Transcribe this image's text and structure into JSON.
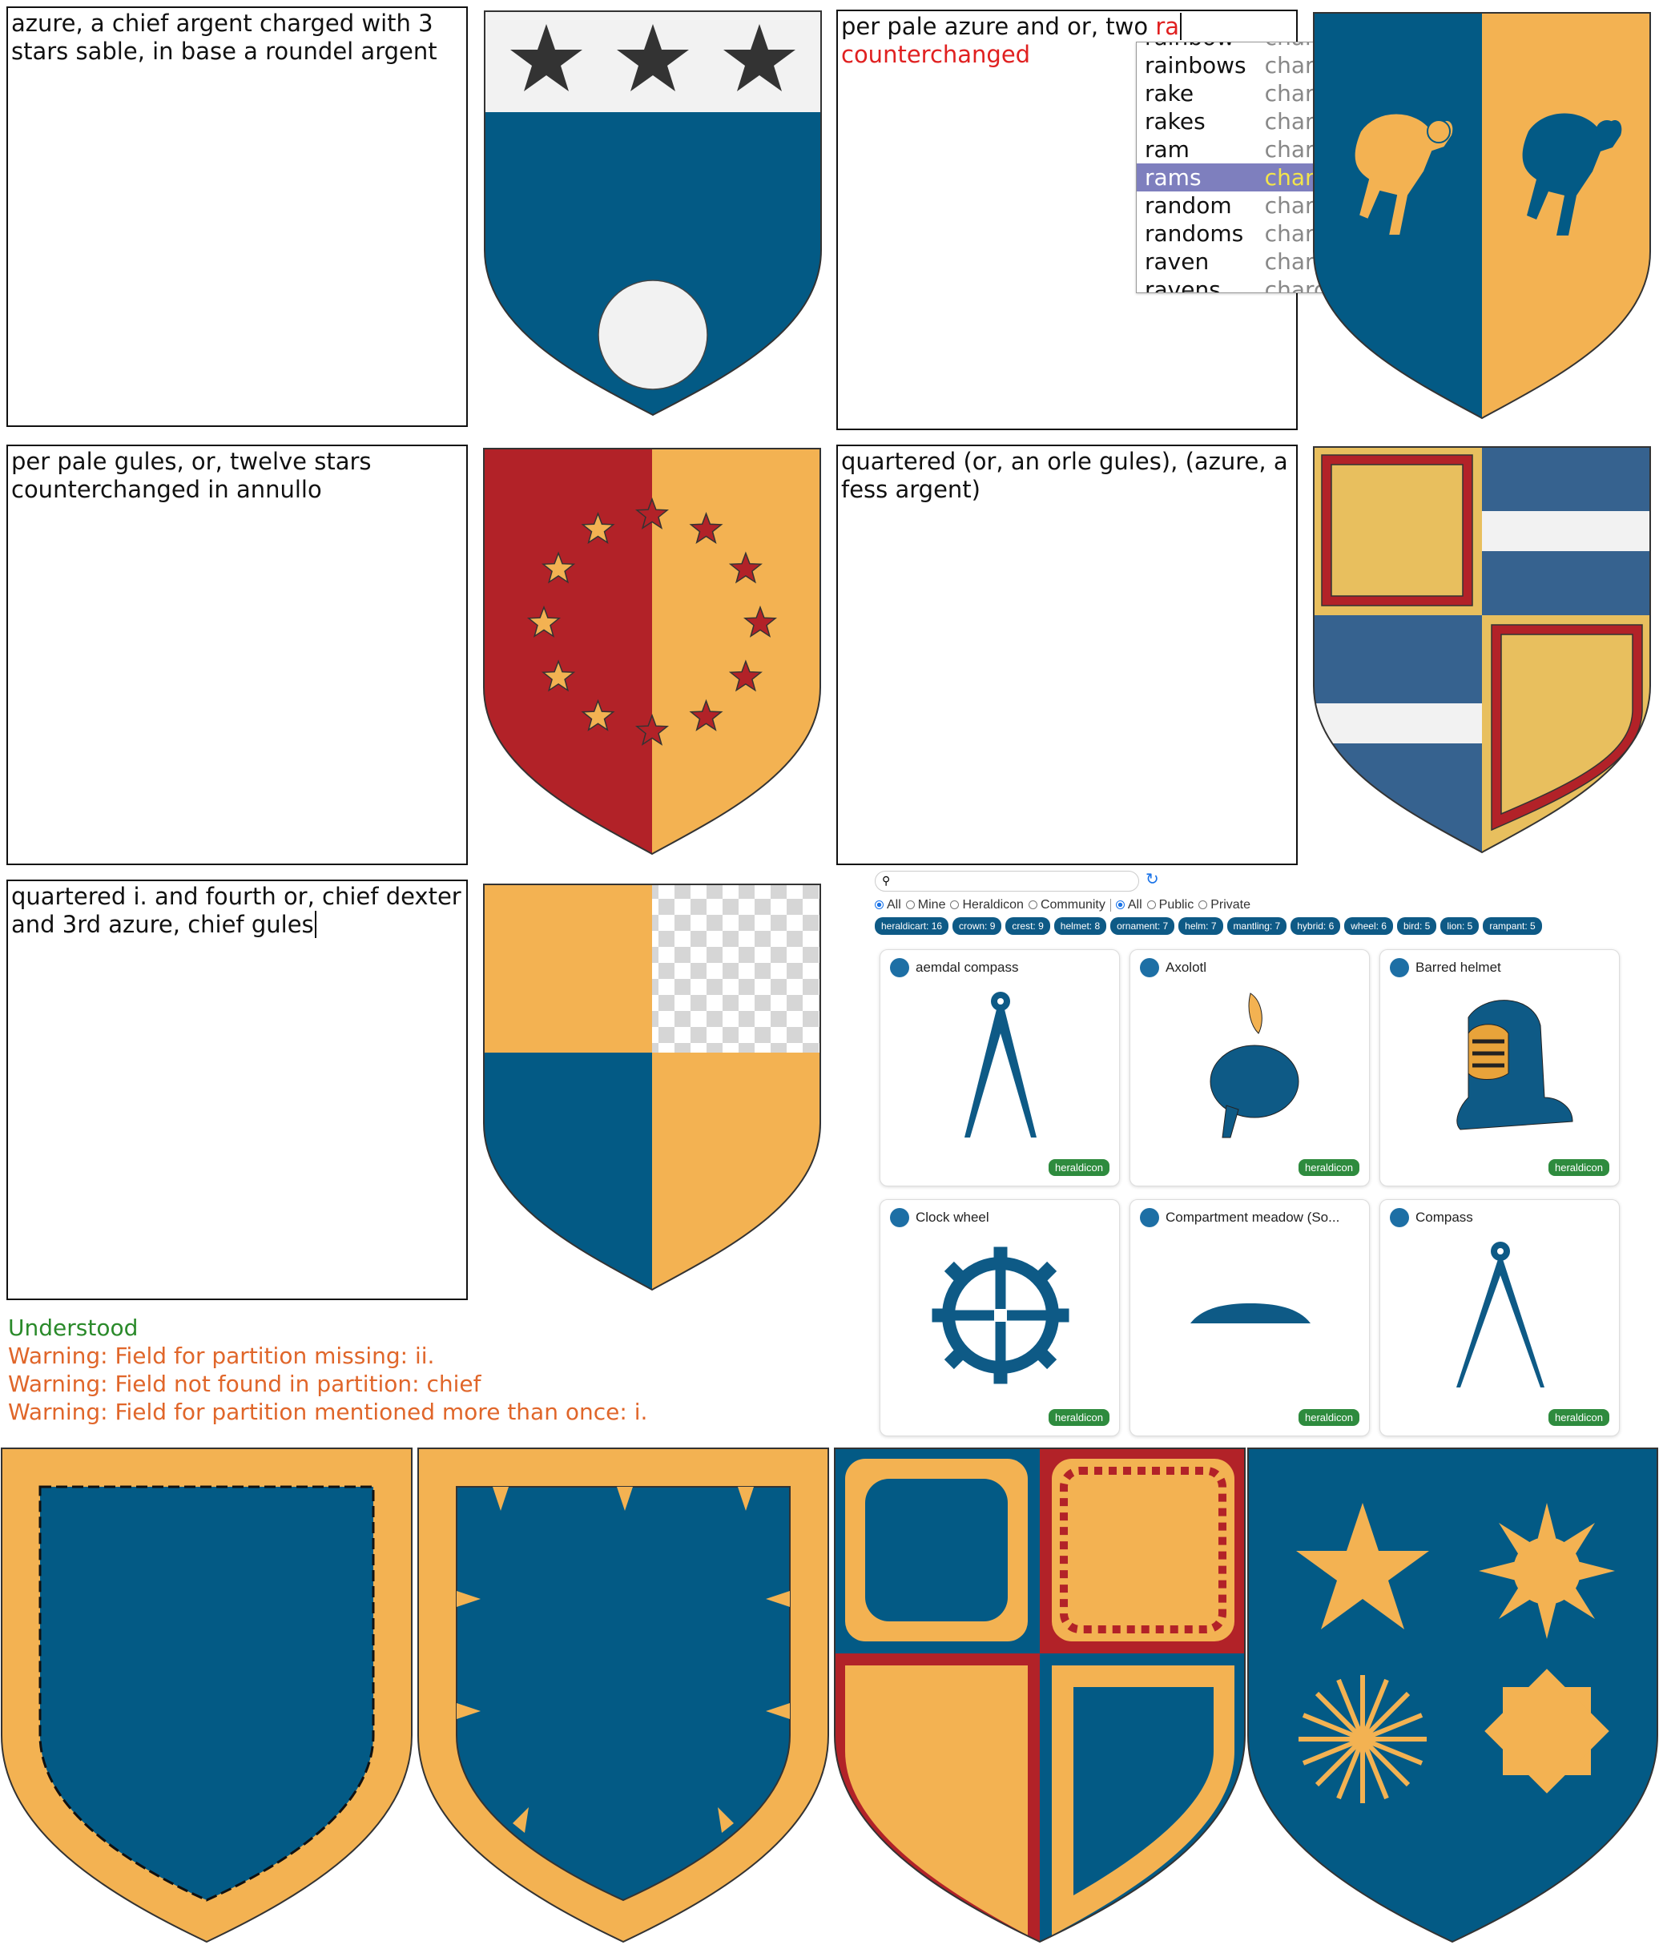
{
  "colors": {
    "azure": "#035a85",
    "or": "#f3b252",
    "gules": "#b22228",
    "argent": "#f2f2f2",
    "sable": "#333333"
  },
  "examples": [
    {
      "blazon": "azure, a chief argent charged with 3 stars sable, in base a roundel argent"
    },
    {
      "blazon_plain": "per pale azure and or, two ",
      "blazon_typed": "ra",
      "blazon_rest": "counterchanged"
    },
    {
      "blazon": "per pale gules, or, twelve stars counterchanged in annullo"
    },
    {
      "blazon": "quartered (or, an orle gules), (azure, a fess argent)"
    },
    {
      "blazon": "quartered i. and fourth or, chief dexter and 3rd azure, chief gules"
    }
  ],
  "autocomplete": {
    "items": [
      {
        "word": "rainbow",
        "kind": "charge"
      },
      {
        "word": "rainbows",
        "kind": "charge"
      },
      {
        "word": "rake",
        "kind": "charge"
      },
      {
        "word": "rakes",
        "kind": "charge"
      },
      {
        "word": "ram",
        "kind": "charge"
      },
      {
        "word": "rams",
        "kind": "charge",
        "selected": true
      },
      {
        "word": "random",
        "kind": "charge"
      },
      {
        "word": "randoms",
        "kind": "charge"
      },
      {
        "word": "raven",
        "kind": "charge"
      },
      {
        "word": "ravens",
        "kind": "charge"
      }
    ]
  },
  "messages": {
    "understood": "Understood",
    "warnings": [
      "Warning: Field for partition missing: ii.",
      "Warning: Field not found in partition: chief",
      "Warning: Field for partition mentioned more than once: i."
    ]
  },
  "library": {
    "search_placeholder": "",
    "scope_filters": [
      "All",
      "Mine",
      "Heraldicon",
      "Community"
    ],
    "visibility_filters": [
      "All",
      "Public",
      "Private"
    ],
    "tags": [
      "heraldicart: 16",
      "crown: 9",
      "crest: 9",
      "helmet: 8",
      "ornament: 7",
      "helm: 7",
      "mantling: 7",
      "hybrid: 6",
      "wheel: 6",
      "bird: 5",
      "lion: 5",
      "rampant: 5"
    ],
    "cards": [
      {
        "title": "aemdal compass",
        "badge": "heraldicon",
        "icon": "compass-charge-icon"
      },
      {
        "title": "Axolotl",
        "badge": "heraldicon",
        "icon": "axolotl-charge-icon"
      },
      {
        "title": "Barred helmet",
        "badge": "heraldicon",
        "icon": "helmet-charge-icon"
      },
      {
        "title": "Clock wheel",
        "badge": "heraldicon",
        "icon": "clock-wheel-charge-icon"
      },
      {
        "title": "Compartment meadow (So...",
        "badge": "heraldicon",
        "icon": "meadow-charge-icon"
      },
      {
        "title": "Compass",
        "badge": "heraldicon",
        "icon": "compass-charge-icon"
      }
    ]
  }
}
